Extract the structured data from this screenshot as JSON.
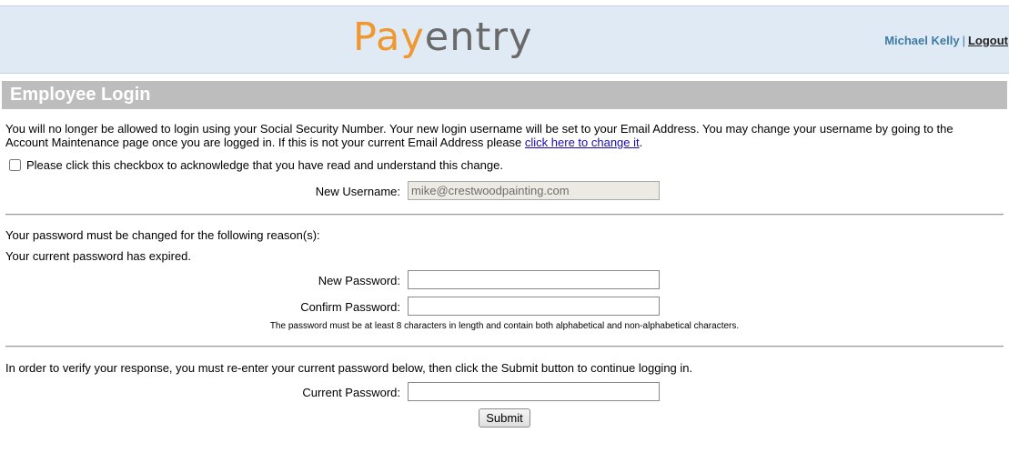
{
  "header": {
    "logo_pay": "Pay",
    "logo_entry": "entry",
    "user_name": "Michael Kelly",
    "separator": "|",
    "logout_label": "Logout",
    "colors": {
      "background": "#dfeaf4",
      "logo_orange": "#f0972f",
      "logo_gray": "#6a6a6a",
      "user_blue": "#3e7ba3"
    }
  },
  "page": {
    "title": "Employee Login"
  },
  "notice": {
    "text_before_link": "You will no longer be allowed to login using your Social Security Number. Your new login username will be set to your Email Address. You may change your username by going to the Account Maintenance page once you are logged in. If this is not your current Email Address please ",
    "link_text": "click here to change it",
    "text_after_link": "."
  },
  "acknowledge": {
    "label": "Please click this checkbox to acknowledge that you have read and understand this change.",
    "checked": false
  },
  "new_username": {
    "label": "New Username:",
    "value": "mike@crestwoodpainting.com"
  },
  "password_change": {
    "reason_intro": "Your password must be changed for the following reason(s):",
    "reason": "Your current password has expired.",
    "new_password_label": "New Password:",
    "new_password_value": "",
    "confirm_password_label": "Confirm Password:",
    "confirm_password_value": "",
    "requirements": "The password must be at least 8 characters in length and contain both alphabetical and non-alphabetical characters."
  },
  "verify": {
    "instructions": "In order to verify your response, you must re-enter your current password below, then click the Submit button to continue logging in.",
    "current_password_label": "Current Password:",
    "current_password_value": "",
    "submit_label": "Submit"
  }
}
